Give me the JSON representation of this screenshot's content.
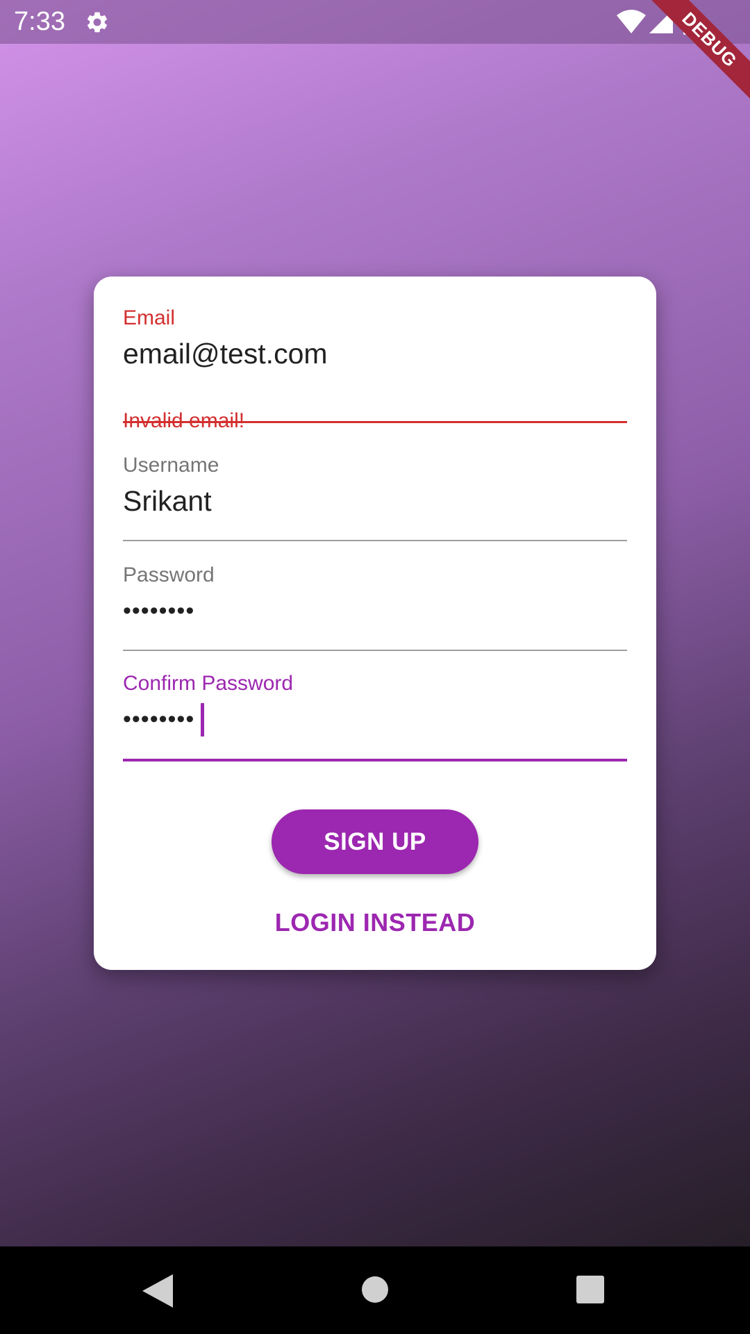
{
  "status_bar": {
    "time": "7:33",
    "icons": [
      "gear-icon",
      "wifi-icon",
      "signal-icon",
      "battery-icon"
    ]
  },
  "debug_banner": {
    "label": "DEBUG"
  },
  "form": {
    "email": {
      "label": "Email",
      "value": "email@test.com",
      "error": "Invalid email!",
      "state": "error"
    },
    "username": {
      "label": "Username",
      "value": "Srikant"
    },
    "password": {
      "label": "Password",
      "value": "••••••••"
    },
    "confirm_password": {
      "label": "Confirm Password",
      "value": "••••••••",
      "state": "focused"
    },
    "signup_label": "SIGN UP",
    "login_label": "LOGIN INSTEAD"
  },
  "colors": {
    "accent": "#9c27b0",
    "error": "#d32f2f",
    "card": "#ffffff"
  },
  "nav_bar": {
    "icons": [
      "back-icon",
      "home-icon",
      "recents-icon"
    ]
  }
}
